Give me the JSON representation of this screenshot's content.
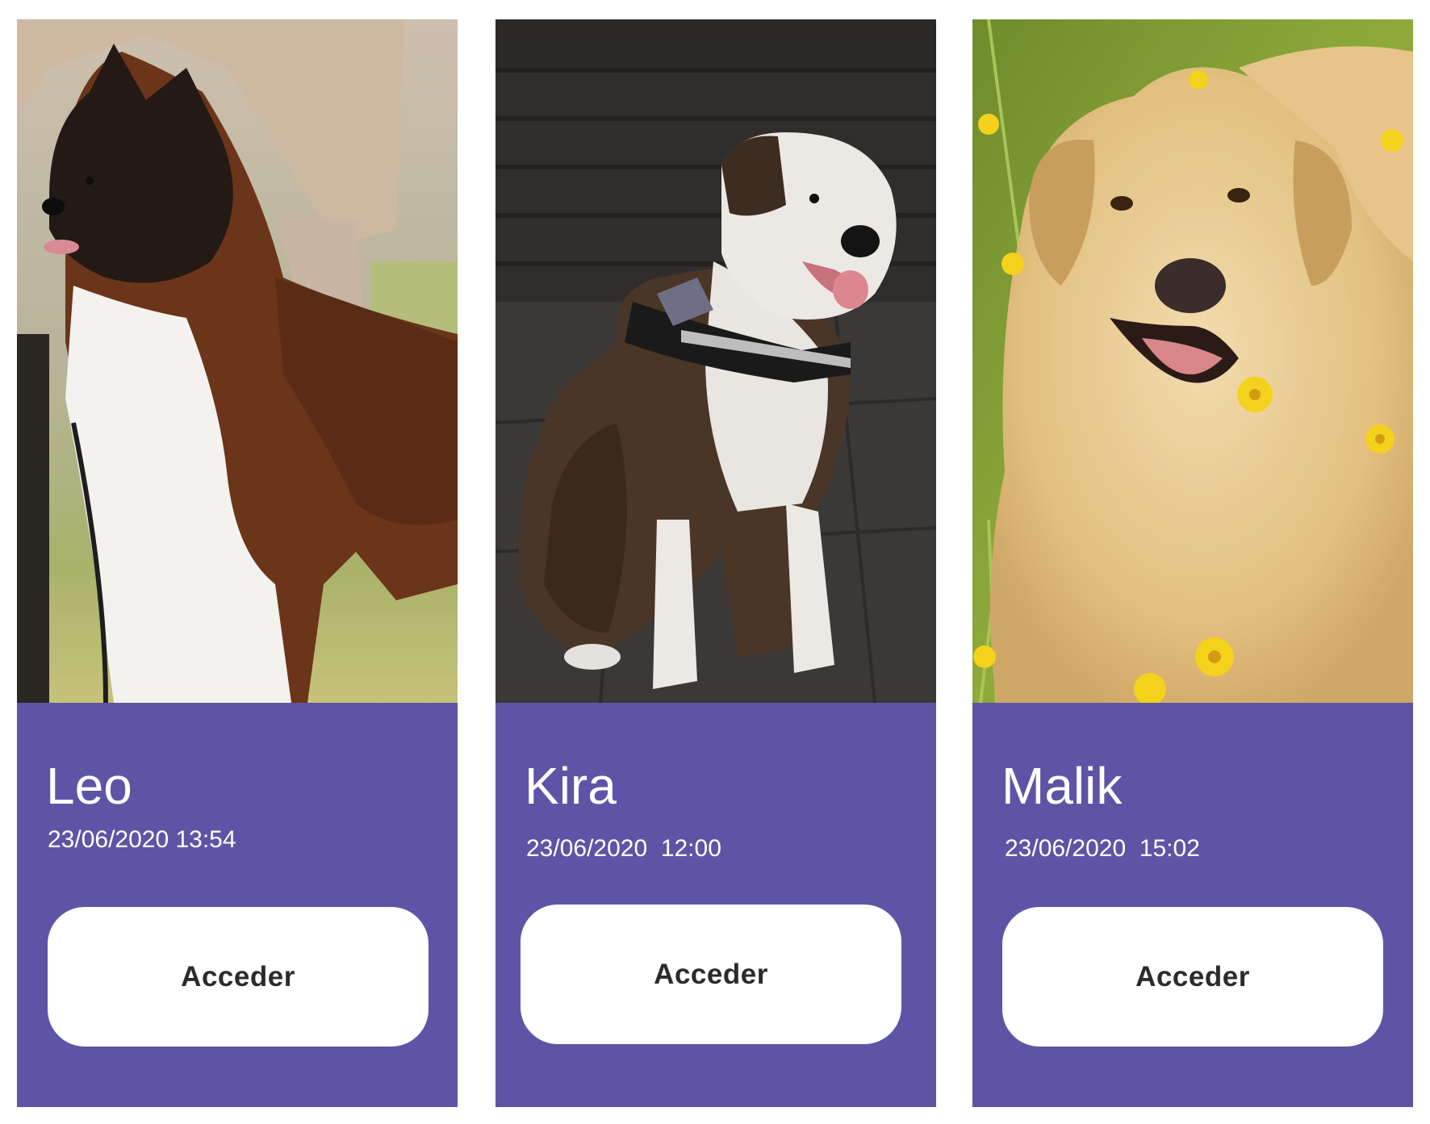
{
  "pets": [
    {
      "name": "Leo",
      "datetime": "23/06/2020 13:54",
      "action_label": "Acceder",
      "photo": "akita-dog-photo"
    },
    {
      "name": "Kira",
      "datetime": "23/06/2020  12:00",
      "action_label": "Acceder",
      "photo": "staffordshire-dog-photo"
    },
    {
      "name": "Malik",
      "datetime": "23/06/2020  15:02",
      "action_label": "Acceder",
      "photo": "golden-retriever-photo"
    }
  ],
  "colors": {
    "card_background": "#5e54a6",
    "button_background": "#ffffff",
    "button_text": "#2b2b2b",
    "text": "#ffffff"
  }
}
